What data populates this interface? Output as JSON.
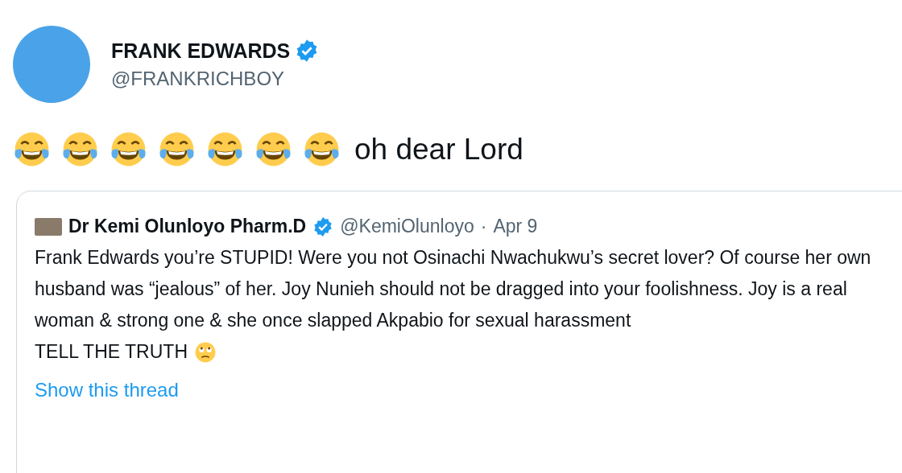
{
  "author": {
    "name": "FRANK EDWARDS",
    "verified": true,
    "handle": "@FRANKRICHBOY"
  },
  "tweet": {
    "emojis": [
      {
        "kind": "tears-of-joy"
      },
      {
        "kind": "tears-of-joy"
      },
      {
        "kind": "tears-of-joy"
      },
      {
        "kind": "tears-of-joy"
      },
      {
        "kind": "tears-of-joy"
      },
      {
        "kind": "tears-of-joy"
      },
      {
        "kind": "tears-of-joy"
      }
    ],
    "text": "oh dear Lord"
  },
  "quote": {
    "name": "Dr Kemi Olunloyo Pharm.D",
    "verified": true,
    "handle": "@KemiOlunloyo",
    "separator": "·",
    "date": "Apr 9",
    "text": "Frank Edwards you’re STUPID! Were you not Osinachi Nwachukwu’s secret lover? Of course her own husband was “jealous” of her. Joy Nunieh should not be dragged into your foolishness. Joy is a real woman & strong one & she once slapped Akpabio for sexual harassment",
    "last_line": "TELL THE TRUTH",
    "last_emoji": {
      "kind": "eye-roll"
    },
    "link": "Show this thread"
  }
}
